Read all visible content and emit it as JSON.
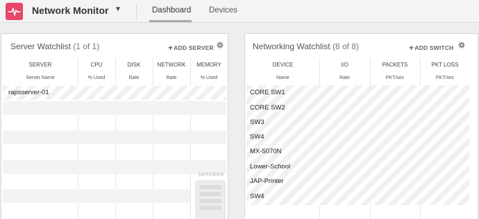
{
  "header": {
    "app_title": "Network Monitor",
    "tabs": [
      {
        "label": "Dashboard",
        "active": true
      },
      {
        "label": "Devices",
        "active": false
      }
    ]
  },
  "server_panel": {
    "title": "Server Watchlist",
    "count": "(1 of 1)",
    "action_label": "ADD SERVER",
    "columns": [
      {
        "name": "SERVER",
        "unit": "Server Name"
      },
      {
        "name": "CPU",
        "unit": "% Used"
      },
      {
        "name": "DISK",
        "unit": "Rate"
      },
      {
        "name": "NETWORK",
        "unit": "Rate"
      },
      {
        "name": "MEMORY",
        "unit": "% Used"
      }
    ],
    "rows": [
      {
        "name": "rapsserver-01",
        "cpu": "",
        "disk": "",
        "network": "",
        "memory": ""
      }
    ],
    "empty_state_label": "SERVERS"
  },
  "network_panel": {
    "title": "Networking Watchlist",
    "count": "(8 of 8)",
    "action_label": "ADD SWITCH",
    "columns": [
      {
        "name": "DEVICE",
        "unit": "Name"
      },
      {
        "name": "I/O",
        "unit": "Rate"
      },
      {
        "name": "PACKETS",
        "unit": "PKT/sec"
      },
      {
        "name": "PKT LOSS",
        "unit": "PKT/sec"
      }
    ],
    "rows": [
      {
        "name": "CORE SW1"
      },
      {
        "name": "CORE SW2"
      },
      {
        "name": "SW3"
      },
      {
        "name": "SW4"
      },
      {
        "name": "MX-5070N"
      },
      {
        "name": "Lower-School"
      },
      {
        "name": "JAP-Printer"
      },
      {
        "name": "SW4"
      }
    ]
  },
  "colors": {
    "brand": "#e8466a",
    "stripe": "#f0f0f0",
    "text": "#333333"
  },
  "icons": [
    "pulse-logo-icon",
    "chevron-down-icon",
    "plus-icon",
    "gear-icon",
    "server-rack-icon"
  ]
}
